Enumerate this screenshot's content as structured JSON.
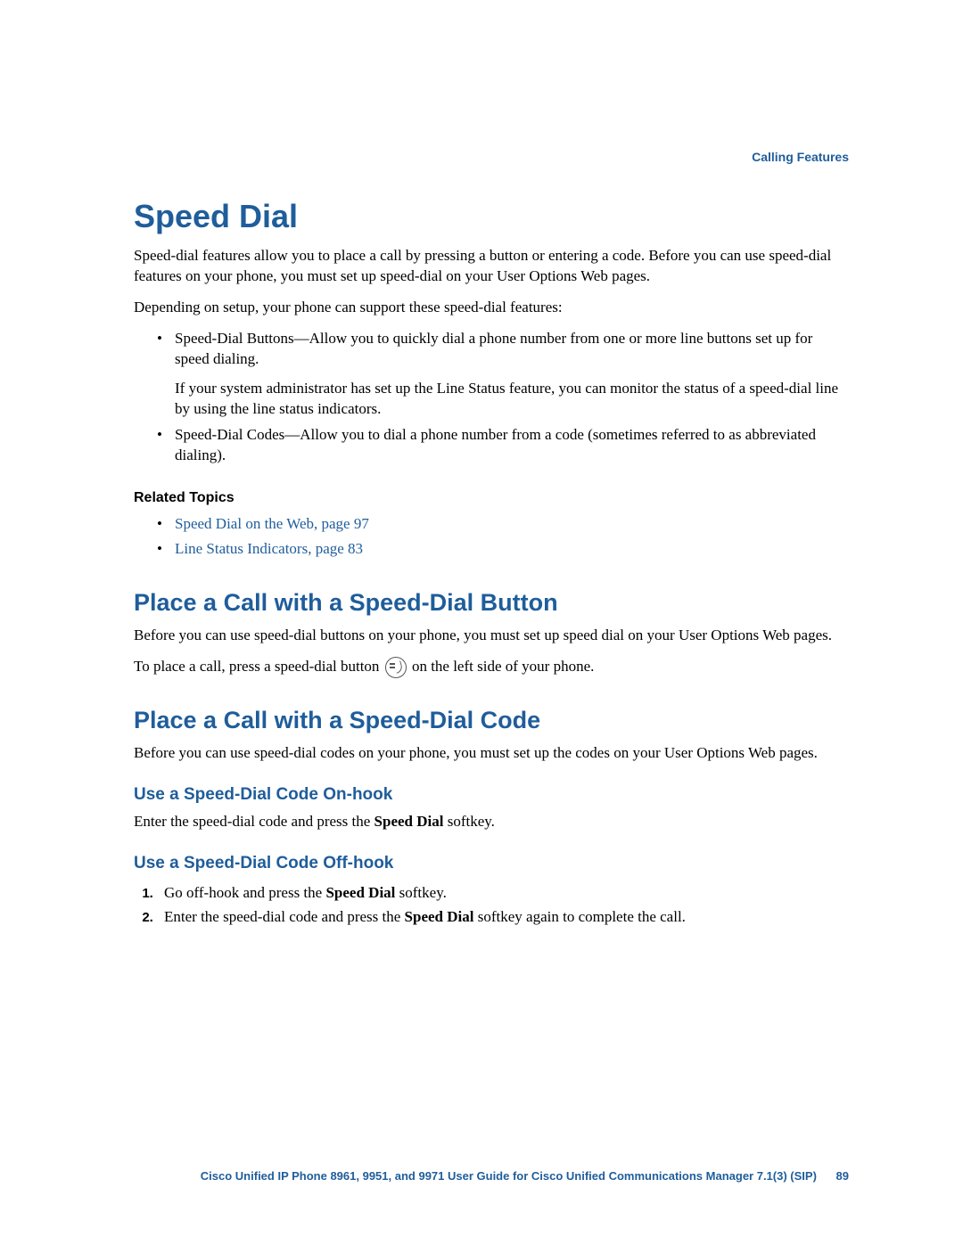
{
  "header": {
    "section": "Calling Features"
  },
  "title": "Speed Dial",
  "intro1": "Speed-dial features allow you to place a call by pressing a button or entering a code. Before you can use speed-dial features on your phone, you must set up speed-dial on your User Options Web pages.",
  "intro2": "Depending on setup, your phone can support these speed-dial features:",
  "features": [
    {
      "text": "Speed-Dial Buttons—Allow you to quickly dial a phone number from one or more line buttons set up for speed dialing.",
      "note": "If your system administrator has set up the Line Status feature, you can monitor the status of a speed-dial line by using the line status indicators."
    },
    {
      "text": "Speed-Dial Codes—Allow you to dial a phone number from a code (sometimes referred to as abbreviated dialing).",
      "note": null
    }
  ],
  "related": {
    "heading": "Related Topics",
    "links": [
      "Speed Dial on the Web, page 97",
      "Line Status Indicators, page 83"
    ]
  },
  "section1": {
    "heading": "Place a Call with a Speed-Dial Button",
    "para1": "Before you can use speed-dial buttons on your phone, you must set up speed dial on your User Options Web pages.",
    "para2a": "To place a call, press a speed-dial button ",
    "para2b": " on the left side of your phone."
  },
  "section2": {
    "heading": "Place a Call with a Speed-Dial Code",
    "para1": "Before you can use speed-dial codes on your phone, you must set up the codes on your User Options Web pages.",
    "sub1": {
      "heading": "Use a Speed-Dial Code On-hook",
      "text_a": "Enter the speed-dial code and press the ",
      "text_bold": "Speed Dial",
      "text_b": " softkey."
    },
    "sub2": {
      "heading": "Use a Speed-Dial Code Off-hook",
      "steps": [
        {
          "a": "Go off-hook and press the ",
          "bold": "Speed Dial",
          "b": " softkey."
        },
        {
          "a": "Enter the speed-dial code and press the ",
          "bold": "Speed Dial",
          "b": " softkey again to complete the call."
        }
      ]
    }
  },
  "footer": {
    "text": "Cisco Unified IP Phone 8961, 9951, and 9971 User Guide for Cisco Unified Communications Manager 7.1(3) (SIP)",
    "page": "89"
  }
}
